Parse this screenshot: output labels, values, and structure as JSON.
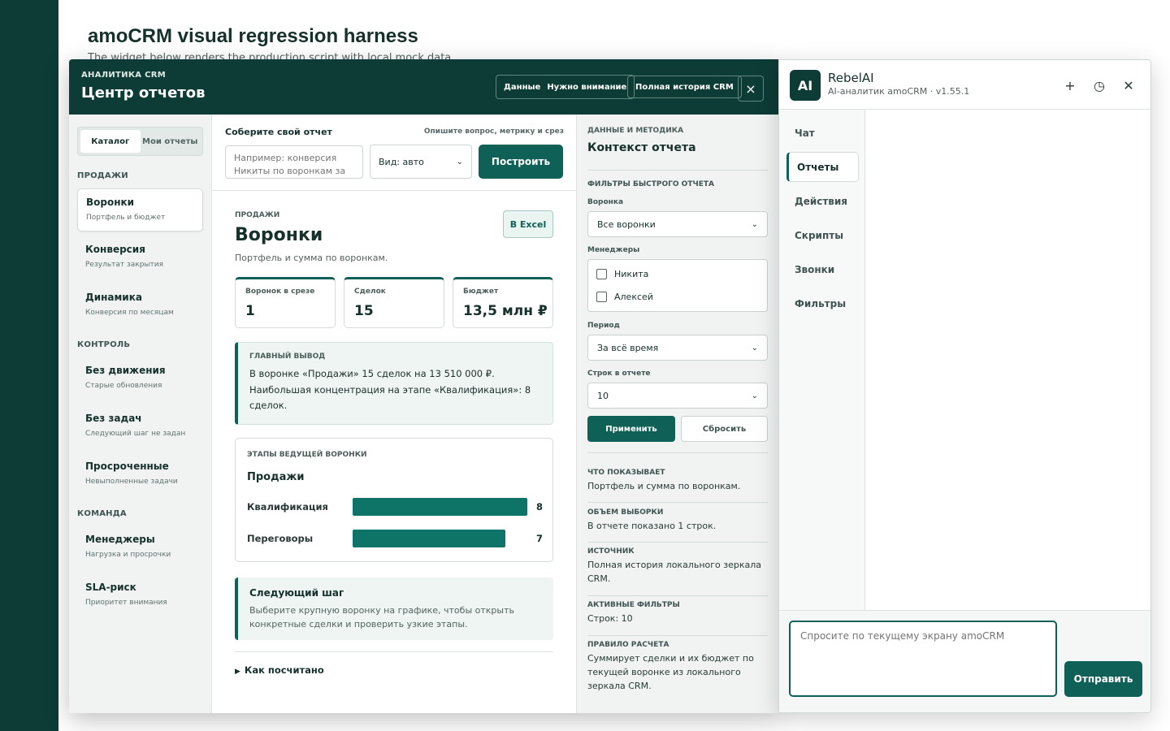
{
  "page": {
    "title": "amoCRM visual regression harness",
    "subtitle": "The widget below renders the production script with local mock data."
  },
  "modal": {
    "kicker": "АНАЛИТИКА CRM",
    "title": "Центр отчетов",
    "header_group": {
      "data_label": "Данные",
      "attention_label": "Нужно внимание"
    },
    "history_button": "Полная история CRM",
    "close_icon": "×"
  },
  "left_nav": {
    "tabs": [
      {
        "label": "Каталог",
        "active": true
      },
      {
        "label": "Мои отчеты",
        "active": false
      }
    ],
    "sections": [
      {
        "title": "ПРОДАЖИ",
        "items": [
          {
            "title": "Воронки",
            "sub": "Портфель и бюджет",
            "active": true
          },
          {
            "title": "Конверсия",
            "sub": "Результат закрытия"
          },
          {
            "title": "Динамика",
            "sub": "Конверсия по месяцам"
          }
        ]
      },
      {
        "title": "КОНТРОЛЬ",
        "items": [
          {
            "title": "Без движения",
            "sub": "Старые обновления"
          },
          {
            "title": "Без задач",
            "sub": "Следующий шаг не задан"
          },
          {
            "title": "Просроченные",
            "sub": "Невыполненные задачи"
          }
        ]
      },
      {
        "title": "КОМАНДА",
        "items": [
          {
            "title": "Менеджеры",
            "sub": "Нагрузка и просрочки"
          },
          {
            "title": "SLA-риск",
            "sub": "Приоритет внимания"
          }
        ]
      }
    ]
  },
  "builder": {
    "title": "Соберите свой отчет",
    "hint": "Опишите вопрос, метрику и срез",
    "placeholder": "Например: конверсия Никиты по воронкам за",
    "view_select": "Вид: авто",
    "build_button": "Построить"
  },
  "report": {
    "kicker": "ПРОДАЖИ",
    "title": "Воронки",
    "description": "Портфель и сумма по воронкам.",
    "export_button": "В Excel",
    "kpis": [
      {
        "label": "Воронок в срезе",
        "value": "1"
      },
      {
        "label": "Сделок",
        "value": "15"
      },
      {
        "label": "Бюджет",
        "value": "13,5 млн ₽"
      }
    ],
    "conclusion": {
      "kicker": "ГЛАВНЫЙ ВЫВОД",
      "body": "В воронке «Продажи» 15 сделок на 13 510 000 ₽. Наибольшая концентрация на этапе «Квалификация»: 8 сделок."
    },
    "stages": {
      "kicker": "ЭТАПЫ ВЕДУЩЕЙ ВОРОНКИ",
      "funnel": "Продажи",
      "max": 8,
      "rows": [
        {
          "label": "Квалификация",
          "value": 8
        },
        {
          "label": "Переговоры",
          "value": 7
        }
      ]
    },
    "next_step": {
      "title": "Следующий шаг",
      "body": "Выберите крупную воронку на графике, чтобы открыть конкретные сделки и проверить узкие этапы."
    },
    "how_calculated": "Как посчитано",
    "how_icon": "▶"
  },
  "context": {
    "kicker": "ДАННЫЕ И МЕТОДИКА",
    "title": "Контекст отчета",
    "filters_title": "ФИЛЬТРЫ БЫСТРОГО ОТЧЕТА",
    "funnel_label": "Воронка",
    "funnel_value": "Все воронки",
    "managers_label": "Менеджеры",
    "managers": [
      {
        "name": "Никита",
        "checked": false
      },
      {
        "name": "Алексей",
        "checked": false
      }
    ],
    "period_label": "Период",
    "period_value": "За всё время",
    "rows_label": "Строк в отчете",
    "rows_value": "10",
    "apply_button": "Применить",
    "reset_button": "Сбросить",
    "chevron": "⌄",
    "info": [
      {
        "key": "ЧТО ПОКАЗЫВАЕТ",
        "value": "Портфель и сумма по воронкам."
      },
      {
        "key": "ОБЪЕМ ВЫБОРКИ",
        "value": "В отчете показано 1 строк."
      },
      {
        "key": "ИСТОЧНИК",
        "value": "Полная история локального зеркала CRM."
      },
      {
        "key": "АКТИВНЫЕ ФИЛЬТРЫ",
        "value": "Строк: 10"
      },
      {
        "key": "ПРАВИЛО РАСЧЕТА",
        "value": "Суммирует сделки и их бюджет по текущей воронке из локального зеркала CRM."
      }
    ]
  },
  "assistant": {
    "logo": "AI",
    "name": "RebelAI",
    "version": "AI-аналитик amoCRM · v1.55.1",
    "controls": {
      "plus": "+",
      "history": "◷",
      "close": "✕"
    },
    "tabs": [
      {
        "label": "Чат",
        "active": false
      },
      {
        "label": "Отчеты",
        "active": true
      },
      {
        "label": "Действия",
        "active": false
      },
      {
        "label": "Скрипты",
        "active": false
      },
      {
        "label": "Звонки",
        "active": false
      },
      {
        "label": "Фильтры",
        "active": false
      }
    ],
    "input_placeholder": "Спросите по текущему экрану amoCRM",
    "send_button": "Отправить"
  },
  "colors": {
    "brand_dark": "#0d3b35",
    "accent": "#0f6158",
    "bar": "#0f7468"
  }
}
